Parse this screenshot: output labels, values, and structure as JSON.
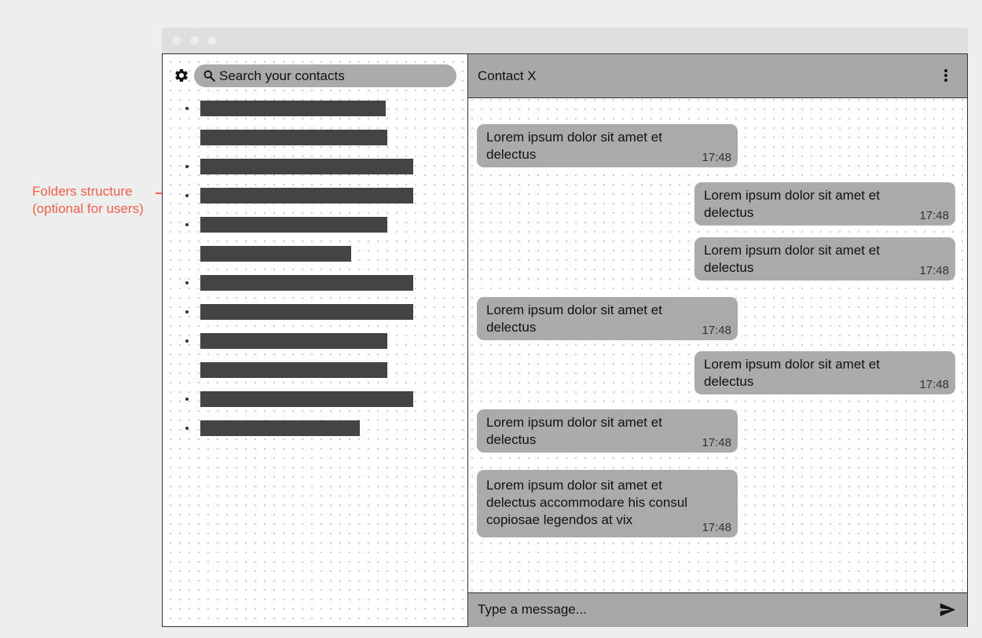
{
  "annotation": {
    "line1": "Folders structure",
    "line2": "(optional for users)",
    "color": "#f0604a"
  },
  "sidebar": {
    "settings_icon": "gear-icon",
    "search": {
      "icon": "search-icon",
      "placeholder": "Search your contacts"
    },
    "contacts": [
      {
        "bullet": true,
        "length": 0.87
      },
      {
        "bullet": false,
        "length": 0.88
      },
      {
        "bullet": true,
        "length": 1.0
      },
      {
        "bullet": true,
        "length": 1.0
      },
      {
        "bullet": true,
        "length": 0.88
      },
      {
        "bullet": false,
        "length": 0.71
      },
      {
        "bullet": true,
        "length": 1.0
      },
      {
        "bullet": true,
        "length": 1.0
      },
      {
        "bullet": true,
        "length": 0.88
      },
      {
        "bullet": false,
        "length": 0.88
      },
      {
        "bullet": true,
        "length": 1.0
      },
      {
        "bullet": true,
        "length": 0.75
      }
    ]
  },
  "chat": {
    "contact_name": "Contact X",
    "menu_icon": "more-vertical-icon",
    "messages": [
      {
        "direction": "in",
        "text": "Lorem ipsum dolor sit amet et delectus",
        "time": "17:48"
      },
      {
        "direction": "out",
        "text": "Lorem ipsum dolor sit amet et delectus",
        "time": "17:48"
      },
      {
        "direction": "out",
        "text": "Lorem ipsum dolor sit amet et delectus",
        "time": "17:48"
      },
      {
        "direction": "in",
        "text": "Lorem ipsum dolor sit amet et delectus",
        "time": "17:48"
      },
      {
        "direction": "out",
        "text": "Lorem ipsum dolor sit amet et delectus",
        "time": "17:48"
      },
      {
        "direction": "in",
        "text": "Lorem ipsum dolor sit amet et delectus",
        "time": "17:48"
      },
      {
        "direction": "in",
        "text": "Lorem ipsum dolor sit amet et delectus accommodare his consul copiosae legendos at vix",
        "time": "17:48"
      }
    ],
    "composer": {
      "placeholder": "Type a message...",
      "send_icon": "send-icon"
    }
  },
  "colors": {
    "panel": "#a8a8a8",
    "bubble": "#aaaaaa",
    "contact_bar": "#444444",
    "annotation": "#f0604a"
  }
}
